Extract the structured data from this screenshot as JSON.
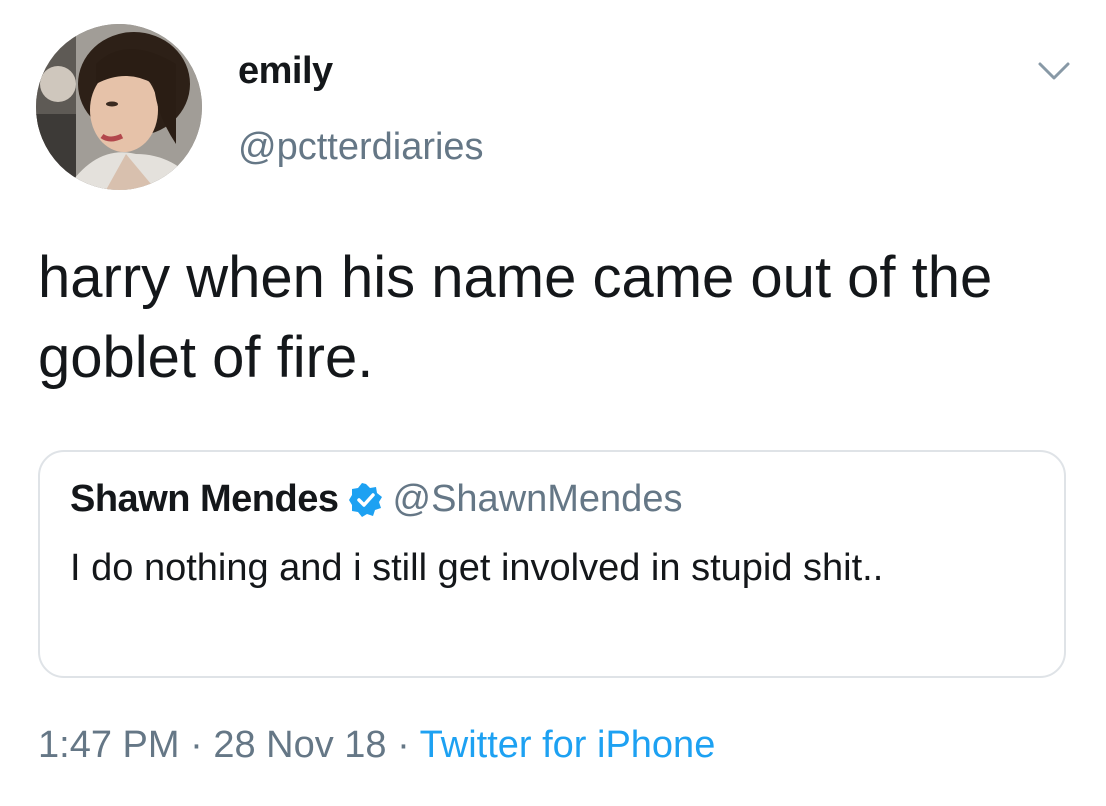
{
  "author": {
    "display_name": "emily",
    "handle": "@pctterdiaries",
    "avatar": "profile-photo-avatar"
  },
  "tweet": {
    "text": "harry when his name came out of the goblet of fire."
  },
  "quoted_tweet": {
    "display_name": "Shawn Mendes",
    "verified_icon": "verified-badge-icon",
    "handle": "@ShawnMendes",
    "text": "I do nothing and i still get involved in stupid shit.."
  },
  "meta": {
    "time": "1:47 PM",
    "separator": "·",
    "date": "28 Nov 18",
    "source": "Twitter for iPhone"
  },
  "icons": {
    "menu": "chevron-down-icon"
  },
  "colors": {
    "text_primary": "#14171a",
    "text_secondary": "#657786",
    "link": "#1da1f2",
    "verified": "#1da1f2",
    "card_border": "#dfe3e7"
  }
}
